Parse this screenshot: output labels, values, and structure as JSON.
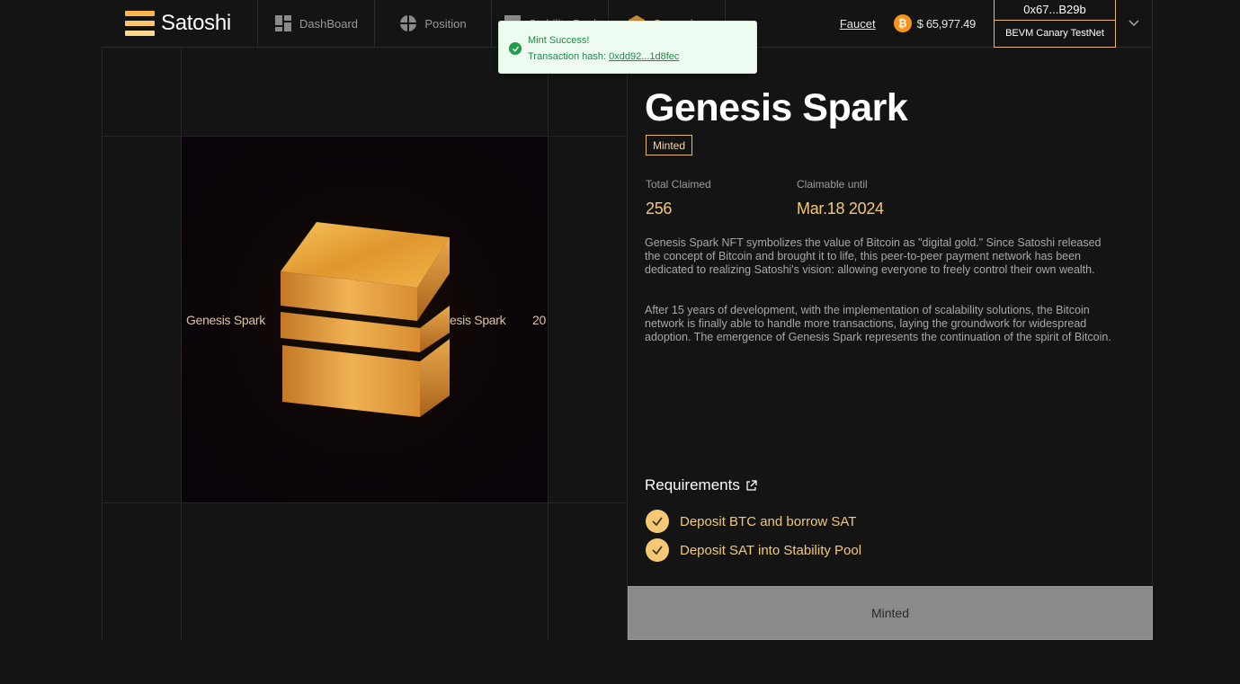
{
  "brand": {
    "name": "Satoshi",
    "colors": [
      "#f7b54a",
      "#f9c66b",
      "#fbd98d"
    ]
  },
  "nav": [
    {
      "label": "DashBoard",
      "icon": "dashboard-icon"
    },
    {
      "label": "Position",
      "icon": "position-icon"
    },
    {
      "label": "Stability Pool",
      "icon": "stability-pool-icon"
    },
    {
      "label": "Campaign",
      "icon": "campaign-icon"
    }
  ],
  "header": {
    "faucet": "Faucet",
    "btc_price": "$ 65,977.49",
    "wallet_address": "0x67...B29b",
    "network": "BEVM Canary TestNet"
  },
  "toast": {
    "title": "Mint Success!",
    "hash_label": "Transaction hash: ",
    "hash_value": "0xdd92...1d8fec"
  },
  "nft": {
    "title": "Genesis Spark",
    "status_badge": "Minted",
    "marquee_1": "Genesis Spark",
    "marquee_2": "esis Spark",
    "marquee_3": "20",
    "total_claimed_label": "Total Claimed",
    "total_claimed_value": "256",
    "claimable_label": "Claimable until",
    "claimable_value": "Mar.18 2024",
    "description_1": "Genesis Spark NFT symbolizes the value of Bitcoin as \"digital gold.\" Since Satoshi released the concept of Bitcoin and brought it to life, this peer-to-peer payment network has been dedicated to realizing Satoshi's vision: allowing everyone to freely control their own wealth.",
    "description_2": "After 15 years of development, with the implementation of scalability solutions, the Bitcoin network is finally able to handle more transactions, laying the groundwork for widespread adoption. The emergence of Genesis Spark represents the continuation of the spirit of Bitcoin."
  },
  "requirements": {
    "title": "Requirements",
    "items": [
      "Deposit BTC and borrow SAT",
      "Deposit SAT into Stability Pool"
    ]
  },
  "action": {
    "button_label": "Minted"
  }
}
